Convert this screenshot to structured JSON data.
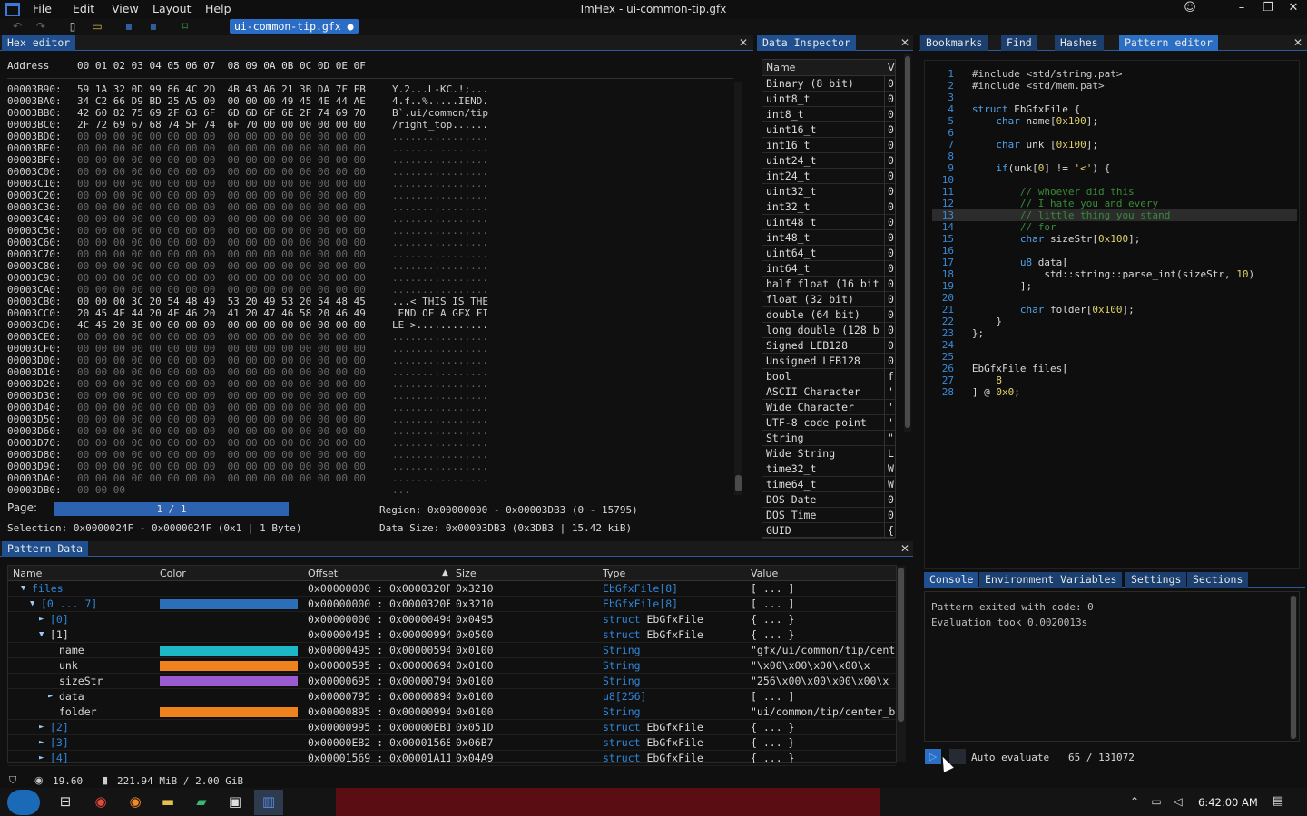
{
  "app": {
    "title": "ImHex - ui-common-tip.gfx",
    "menu": [
      "File",
      "Edit",
      "View",
      "Layout",
      "Help"
    ],
    "file_tab": "ui-common-tip.gfx ●"
  },
  "hex_editor": {
    "tab": "Hex editor",
    "header_address": "Address",
    "header_bytes": "00 01 02 03 04 05 06 07  08 09 0A 0B 0C 0D 0E 0F",
    "rows": [
      {
        "addr": "00003B90:",
        "bytes": "59 1A 32 0D 99 86 4C 2D  4B 43 A6 21 3B DA 7F FB",
        "ascii": "Y.2...L-KC.!;...",
        "z": false
      },
      {
        "addr": "00003BA0:",
        "bytes": "34 C2 66 D9 BD 25 A5 00  00 00 00 49 45 4E 44 AE",
        "ascii": "4.f..%.....IEND.",
        "z": false
      },
      {
        "addr": "00003BB0:",
        "bytes": "42 60 82 75 69 2F 63 6F  6D 6D 6F 6E 2F 74 69 70",
        "ascii": "B`.ui/common/tip",
        "z": false
      },
      {
        "addr": "00003BC0:",
        "bytes": "2F 72 69 67 68 74 5F 74  6F 70 00 00 00 00 00 00",
        "ascii": "/right_top......",
        "z": false
      },
      {
        "addr": "00003BD0:",
        "bytes": "00 00 00 00 00 00 00 00  00 00 00 00 00 00 00 00",
        "ascii": "................",
        "z": true
      },
      {
        "addr": "00003BE0:",
        "bytes": "00 00 00 00 00 00 00 00  00 00 00 00 00 00 00 00",
        "ascii": "................",
        "z": true
      },
      {
        "addr": "00003BF0:",
        "bytes": "00 00 00 00 00 00 00 00  00 00 00 00 00 00 00 00",
        "ascii": "................",
        "z": true
      },
      {
        "addr": "00003C00:",
        "bytes": "00 00 00 00 00 00 00 00  00 00 00 00 00 00 00 00",
        "ascii": "................",
        "z": true
      },
      {
        "addr": "00003C10:",
        "bytes": "00 00 00 00 00 00 00 00  00 00 00 00 00 00 00 00",
        "ascii": "................",
        "z": true
      },
      {
        "addr": "00003C20:",
        "bytes": "00 00 00 00 00 00 00 00  00 00 00 00 00 00 00 00",
        "ascii": "................",
        "z": true
      },
      {
        "addr": "00003C30:",
        "bytes": "00 00 00 00 00 00 00 00  00 00 00 00 00 00 00 00",
        "ascii": "................",
        "z": true
      },
      {
        "addr": "00003C40:",
        "bytes": "00 00 00 00 00 00 00 00  00 00 00 00 00 00 00 00",
        "ascii": "................",
        "z": true
      },
      {
        "addr": "00003C50:",
        "bytes": "00 00 00 00 00 00 00 00  00 00 00 00 00 00 00 00",
        "ascii": "................",
        "z": true
      },
      {
        "addr": "00003C60:",
        "bytes": "00 00 00 00 00 00 00 00  00 00 00 00 00 00 00 00",
        "ascii": "................",
        "z": true
      },
      {
        "addr": "00003C70:",
        "bytes": "00 00 00 00 00 00 00 00  00 00 00 00 00 00 00 00",
        "ascii": "................",
        "z": true
      },
      {
        "addr": "00003C80:",
        "bytes": "00 00 00 00 00 00 00 00  00 00 00 00 00 00 00 00",
        "ascii": "................",
        "z": true
      },
      {
        "addr": "00003C90:",
        "bytes": "00 00 00 00 00 00 00 00  00 00 00 00 00 00 00 00",
        "ascii": "................",
        "z": true
      },
      {
        "addr": "00003CA0:",
        "bytes": "00 00 00 00 00 00 00 00  00 00 00 00 00 00 00 00",
        "ascii": "................",
        "z": true
      },
      {
        "addr": "00003CB0:",
        "bytes": "00 00 00 3C 20 54 48 49  53 20 49 53 20 54 48 45",
        "ascii": "...< THIS IS THE",
        "z": false
      },
      {
        "addr": "00003CC0:",
        "bytes": "20 45 4E 44 20 4F 46 20  41 20 47 46 58 20 46 49",
        "ascii": " END OF A GFX FI",
        "z": false
      },
      {
        "addr": "00003CD0:",
        "bytes": "4C 45 20 3E 00 00 00 00  00 00 00 00 00 00 00 00",
        "ascii": "LE >............",
        "z": false
      },
      {
        "addr": "00003CE0:",
        "bytes": "00 00 00 00 00 00 00 00  00 00 00 00 00 00 00 00",
        "ascii": "................",
        "z": true
      },
      {
        "addr": "00003CF0:",
        "bytes": "00 00 00 00 00 00 00 00  00 00 00 00 00 00 00 00",
        "ascii": "................",
        "z": true
      },
      {
        "addr": "00003D00:",
        "bytes": "00 00 00 00 00 00 00 00  00 00 00 00 00 00 00 00",
        "ascii": "................",
        "z": true
      },
      {
        "addr": "00003D10:",
        "bytes": "00 00 00 00 00 00 00 00  00 00 00 00 00 00 00 00",
        "ascii": "................",
        "z": true
      },
      {
        "addr": "00003D20:",
        "bytes": "00 00 00 00 00 00 00 00  00 00 00 00 00 00 00 00",
        "ascii": "................",
        "z": true
      },
      {
        "addr": "00003D30:",
        "bytes": "00 00 00 00 00 00 00 00  00 00 00 00 00 00 00 00",
        "ascii": "................",
        "z": true
      },
      {
        "addr": "00003D40:",
        "bytes": "00 00 00 00 00 00 00 00  00 00 00 00 00 00 00 00",
        "ascii": "................",
        "z": true
      },
      {
        "addr": "00003D50:",
        "bytes": "00 00 00 00 00 00 00 00  00 00 00 00 00 00 00 00",
        "ascii": "................",
        "z": true
      },
      {
        "addr": "00003D60:",
        "bytes": "00 00 00 00 00 00 00 00  00 00 00 00 00 00 00 00",
        "ascii": "................",
        "z": true
      },
      {
        "addr": "00003D70:",
        "bytes": "00 00 00 00 00 00 00 00  00 00 00 00 00 00 00 00",
        "ascii": "................",
        "z": true
      },
      {
        "addr": "00003D80:",
        "bytes": "00 00 00 00 00 00 00 00  00 00 00 00 00 00 00 00",
        "ascii": "................",
        "z": true
      },
      {
        "addr": "00003D90:",
        "bytes": "00 00 00 00 00 00 00 00  00 00 00 00 00 00 00 00",
        "ascii": "................",
        "z": true
      },
      {
        "addr": "00003DA0:",
        "bytes": "00 00 00 00 00 00 00 00  00 00 00 00 00 00 00 00",
        "ascii": "................",
        "z": true
      },
      {
        "addr": "00003DB0:",
        "bytes": "00 00 00",
        "ascii": "...",
        "z": true
      }
    ],
    "page_label": "Page:",
    "page_value": "1 / 1",
    "region": "Region: 0x00000000 - 0x00003DB3 (0 - 15795)",
    "selection": "Selection: 0x0000024F - 0x0000024F (0x1 | 1 Byte)",
    "data_size": "Data Size: 0x00003DB3 (0x3DB3 | 15.42 kiB)"
  },
  "inspector": {
    "tab": "Data Inspector",
    "col_name": "Name",
    "col_value": "V",
    "rows": [
      {
        "n": "Binary (8 bit)",
        "v": "0"
      },
      {
        "n": "uint8_t",
        "v": "0"
      },
      {
        "n": "int8_t",
        "v": "0"
      },
      {
        "n": "uint16_t",
        "v": "0"
      },
      {
        "n": "int16_t",
        "v": "0"
      },
      {
        "n": "uint24_t",
        "v": "0"
      },
      {
        "n": "int24_t",
        "v": "0"
      },
      {
        "n": "uint32_t",
        "v": "0"
      },
      {
        "n": "int32_t",
        "v": "0"
      },
      {
        "n": "uint48_t",
        "v": "0"
      },
      {
        "n": "int48_t",
        "v": "0"
      },
      {
        "n": "uint64_t",
        "v": "0"
      },
      {
        "n": "int64_t",
        "v": "0"
      },
      {
        "n": "half float (16 bit",
        "v": "0"
      },
      {
        "n": "float (32 bit)",
        "v": "0"
      },
      {
        "n": "double (64 bit)",
        "v": "0"
      },
      {
        "n": "long double (128 b",
        "v": "0"
      },
      {
        "n": "Signed LEB128",
        "v": "0"
      },
      {
        "n": "Unsigned LEB128",
        "v": "0"
      },
      {
        "n": "bool",
        "v": "f"
      },
      {
        "n": "ASCII Character",
        "v": "'"
      },
      {
        "n": "Wide Character",
        "v": "'"
      },
      {
        "n": "UTF-8 code point",
        "v": "'"
      },
      {
        "n": "String",
        "v": "\""
      },
      {
        "n": "Wide String",
        "v": "L"
      },
      {
        "n": "time32_t",
        "v": "W"
      },
      {
        "n": "time64_t",
        "v": "W"
      },
      {
        "n": "DOS Date",
        "v": "0"
      },
      {
        "n": "DOS Time",
        "v": "0"
      },
      {
        "n": "GUID",
        "v": "{"
      }
    ]
  },
  "right_tabs": [
    "Bookmarks",
    "Find",
    "Hashes",
    "Pattern editor"
  ],
  "code_lines": [
    {
      "n": "1",
      "t": "#include <std/string.pat>"
    },
    {
      "n": "2",
      "t": "#include <std/mem.pat>"
    },
    {
      "n": "3",
      "t": ""
    },
    {
      "n": "4",
      "t": "struct EbGfxFile {"
    },
    {
      "n": "5",
      "t": "    char name[0x100];"
    },
    {
      "n": "6",
      "t": ""
    },
    {
      "n": "7",
      "t": "    char unk [0x100];"
    },
    {
      "n": "8",
      "t": ""
    },
    {
      "n": "9",
      "t": "    if(unk[0] != '<') {"
    },
    {
      "n": "10",
      "t": ""
    },
    {
      "n": "11",
      "t": "        // whoever did this"
    },
    {
      "n": "12",
      "t": "        // I hate you and every"
    },
    {
      "n": "13",
      "t": "        // little thing you stand"
    },
    {
      "n": "14",
      "t": "        // for"
    },
    {
      "n": "15",
      "t": "        char sizeStr[0x100];"
    },
    {
      "n": "16",
      "t": ""
    },
    {
      "n": "17",
      "t": "        u8 data["
    },
    {
      "n": "18",
      "t": "            std::string::parse_int(sizeStr, 10)"
    },
    {
      "n": "19",
      "t": "        ];"
    },
    {
      "n": "20",
      "t": ""
    },
    {
      "n": "21",
      "t": "        char folder[0x100];"
    },
    {
      "n": "22",
      "t": "    }"
    },
    {
      "n": "23",
      "t": "};"
    },
    {
      "n": "24",
      "t": ""
    },
    {
      "n": "25",
      "t": ""
    },
    {
      "n": "26",
      "t": "EbGfxFile files["
    },
    {
      "n": "27",
      "t": "    8"
    },
    {
      "n": "28",
      "t": "] @ 0x0;"
    }
  ],
  "console": {
    "tabs": [
      "Console",
      "Environment Variables",
      "Settings",
      "Sections"
    ],
    "lines": [
      "Pattern exited with code: 0",
      "Evaluation took 0.0020013s"
    ],
    "auto_evaluate": "Auto evaluate",
    "counter": "65 / 131072"
  },
  "pattern_data": {
    "tab": "Pattern Data",
    "headers": [
      "Name",
      "Color",
      "Offset",
      "Size",
      "Type",
      "Value"
    ],
    "rows": [
      {
        "indent": 1,
        "arrow": "▼",
        "name": "files",
        "color": "",
        "offset": "0x00000000 : 0x0000320F",
        "size": "0x3210",
        "tk": "",
        "tn": "EbGfxFile[8]",
        "value": "[ ... ]",
        "nameclass": "tblue"
      },
      {
        "indent": 2,
        "arrow": "▼",
        "name": "[0 ... 7]",
        "color": "#2a6fb8",
        "offset": "0x00000000 : 0x0000320F",
        "size": "0x3210",
        "tk": "",
        "tn": "EbGfxFile[8]",
        "value": "[ ... ]",
        "nameclass": "tblue"
      },
      {
        "indent": 3,
        "arrow": "►",
        "name": "[0]",
        "color": "",
        "offset": "0x00000000 : 0x00000494",
        "size": "0x0495",
        "tk": "struct",
        "tn": "EbGfxFile",
        "value": "{ ... }",
        "nameclass": "tblue"
      },
      {
        "indent": 3,
        "arrow": "▼",
        "name": "[1]",
        "color": "",
        "offset": "0x00000495 : 0x00000994",
        "size": "0x0500",
        "tk": "struct",
        "tn": "EbGfxFile",
        "value": "{ ... }",
        "nameclass": ""
      },
      {
        "indent": 4,
        "arrow": "",
        "name": "name",
        "color": "#1cb8c8",
        "offset": "0x00000495 : 0x00000594",
        "size": "0x0100",
        "tk": "",
        "tn": "String",
        "value": "\"gfx/ui/common/tip/cent",
        "nameclass": ""
      },
      {
        "indent": 4,
        "arrow": "",
        "name": "unk",
        "color": "#f0821e",
        "offset": "0x00000595 : 0x00000694",
        "size": "0x0100",
        "tk": "",
        "tn": "String",
        "value": "\"\\x00\\x00\\x00\\x00\\x",
        "nameclass": ""
      },
      {
        "indent": 4,
        "arrow": "",
        "name": "sizeStr",
        "color": "#9a5ad0",
        "offset": "0x00000695 : 0x00000794",
        "size": "0x0100",
        "tk": "",
        "tn": "String",
        "value": "\"256\\x00\\x00\\x00\\x00\\x",
        "nameclass": ""
      },
      {
        "indent": 4,
        "arrow": "►",
        "name": "data",
        "color": "",
        "offset": "0x00000795 : 0x00000894",
        "size": "0x0100",
        "tk": "",
        "tn": "u8[256]",
        "value": "[ ... ]",
        "nameclass": ""
      },
      {
        "indent": 4,
        "arrow": "",
        "name": "folder",
        "color": "#f0821e",
        "offset": "0x00000895 : 0x00000994",
        "size": "0x0100",
        "tk": "",
        "tn": "String",
        "value": "\"ui/common/tip/center_b",
        "nameclass": ""
      },
      {
        "indent": 3,
        "arrow": "►",
        "name": "[2]",
        "color": "",
        "offset": "0x00000995 : 0x00000EB1",
        "size": "0x051D",
        "tk": "struct",
        "tn": "EbGfxFile",
        "value": "{ ... }",
        "nameclass": "tblue"
      },
      {
        "indent": 3,
        "arrow": "►",
        "name": "[3]",
        "color": "",
        "offset": "0x00000EB2 : 0x00001568",
        "size": "0x06B7",
        "tk": "struct",
        "tn": "EbGfxFile",
        "value": "{ ... }",
        "nameclass": "tblue"
      },
      {
        "indent": 3,
        "arrow": "►",
        "name": "[4]",
        "color": "",
        "offset": "0x00001569 : 0x00001A11",
        "size": "0x04A9",
        "tk": "struct",
        "tn": "EbGfxFile",
        "value": "{ ... }",
        "nameclass": "tblue"
      }
    ]
  },
  "status": {
    "fps": "19.60",
    "memory": "221.94 MiB / 2.00 GiB"
  },
  "taskbar": {
    "clock": "6:42:00 AM"
  }
}
